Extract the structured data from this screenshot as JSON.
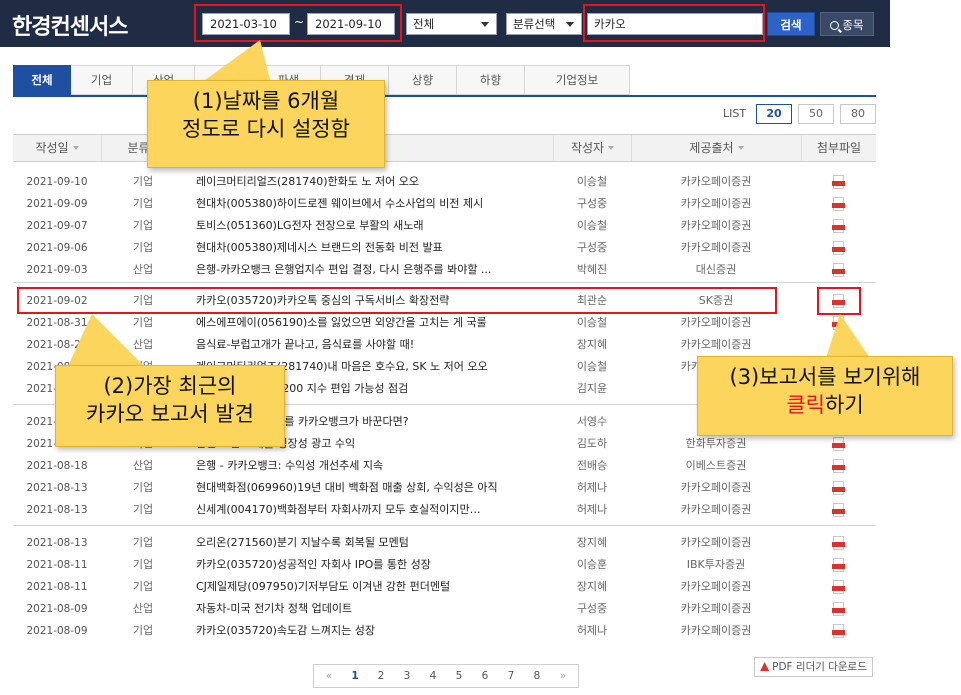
{
  "header": {
    "logo": "한경컨센서스",
    "date_from": "2021-03-10",
    "tilde": "~",
    "date_to": "2021-09-10",
    "type_select": "전체",
    "category_select": "분류선택",
    "search_value": "카카오",
    "search_button": "검색",
    "stock_button": "종목"
  },
  "tabs": [
    "전체",
    "기업",
    "산업",
    "시장",
    "파생",
    "경제",
    "상향",
    "하향",
    "기업정보"
  ],
  "list_size": {
    "label": "LIST",
    "options": [
      "20",
      "50",
      "80"
    ],
    "selected": "20"
  },
  "table": {
    "headers": [
      "작성일",
      "분류",
      "제목",
      "작성자",
      "제공출처",
      "첨부파일"
    ],
    "rows": [
      {
        "date": "2021-09-10",
        "cat": "기업",
        "title": "레이크머티리얼즈(281740)한화도 노 저어 오오",
        "author": "이승철",
        "source": "카카오페이증권"
      },
      {
        "date": "2021-09-09",
        "cat": "기업",
        "title": "현대차(005380)하이드로젠 웨이브에서 수소사업의 비전 제시",
        "author": "구성중",
        "source": "카카오페이증권"
      },
      {
        "date": "2021-09-07",
        "cat": "기업",
        "title": "토비스(051360)LG전자 전장으로 부활의 새노래",
        "author": "이승철",
        "source": "카카오페이증권"
      },
      {
        "date": "2021-09-06",
        "cat": "기업",
        "title": "현대차(005380)제네시스 브랜드의 전동화 비전 발표",
        "author": "구성중",
        "source": "카카오페이증권"
      },
      {
        "date": "2021-09-03",
        "cat": "산업",
        "title": "은행-카카오뱅크 은행업지수 편입 결정, 다시 은행주를 봐야할 ...",
        "author": "박혜진",
        "source": "대신증권"
      },
      {
        "date": "2021-09-02",
        "cat": "기업",
        "title": "카카오(035720)카카오톡 중심의 구독서비스 확장전략",
        "author": "최관순",
        "source": "SK증권"
      },
      {
        "date": "2021-08-31",
        "cat": "기업",
        "title": "에스에프에이(056190)소를 잃었으면 외양간을 고치는 게 국룰",
        "author": "이승철",
        "source": "카카오페이증권"
      },
      {
        "date": "2021-08-26",
        "cat": "산업",
        "title": "음식료-부럽고개가 끝나고, 음식료를 사야할 때!",
        "author": "장지혜",
        "source": "카카오페이증권"
      },
      {
        "date": "2021-08-24",
        "cat": "기업",
        "title": "레이크머티리얼즈(281740)내 마음은 호수요, SK 노 저어 오오",
        "author": "이승철",
        "source": "카카오페이증권"
      },
      {
        "date": "2021-08-23",
        "cat": "시장",
        "title": "카카오뱅크 KOSPI200 지수 편입 가능성 점검",
        "author": "김지윤",
        "source": ""
      },
      {
        "date": "2021-08-20",
        "cat": "산업",
        "title": "은행-은행업의 판도를 카카오뱅크가 바꾼다면?",
        "author": "서영수",
        "source": ""
      },
      {
        "date": "2021-08-19",
        "cat": "기업",
        "title": "관전 포인트 매출 성장성 광고 수익",
        "author": "김도하",
        "source": "한화투자증권"
      },
      {
        "date": "2021-08-18",
        "cat": "산업",
        "title": "은행 - 카카오뱅크: 수익성 개선추세 지속",
        "author": "전배승",
        "source": "이베스트증권"
      },
      {
        "date": "2021-08-13",
        "cat": "기업",
        "title": "현대백화점(069960)19년 대비 백화점 매출 상회, 수익성은 아직",
        "author": "허제나",
        "source": "카카오페이증권"
      },
      {
        "date": "2021-08-13",
        "cat": "기업",
        "title": "신세계(004170)백화점부터 자회사까지 모두 호실적이지만…",
        "author": "허제나",
        "source": "카카오페이증권"
      },
      {
        "date": "2021-08-13",
        "cat": "기업",
        "title": "오리온(271560)분기 지날수록 회복될 모멘텀",
        "author": "장지혜",
        "source": "카카오페이증권"
      },
      {
        "date": "2021-08-11",
        "cat": "기업",
        "title": "카카오(035720)성공적인 자회사 IPO를 통한 성장",
        "author": "이승훈",
        "source": "IBK투자증권"
      },
      {
        "date": "2021-08-11",
        "cat": "기업",
        "title": "CJ제일제당(097950)기저부담도 이겨낸 강한 펀더멘털",
        "author": "장지혜",
        "source": "카카오페이증권"
      },
      {
        "date": "2021-08-09",
        "cat": "산업",
        "title": "자동차-미국 전기차 정책 업데이트",
        "author": "구성중",
        "source": "카카오페이증권"
      },
      {
        "date": "2021-08-09",
        "cat": "기업",
        "title": "카카오(035720)속도감 느껴지는 성장",
        "author": "허제나",
        "source": "카카오페이증권"
      }
    ]
  },
  "pagination": {
    "prev": "«",
    "pages": [
      "1",
      "2",
      "3",
      "4",
      "5",
      "6",
      "7",
      "8"
    ],
    "current": "1",
    "next": "»"
  },
  "pdf_reader_label": "PDF 리더기 다운로드",
  "annotations": {
    "note1": [
      "(1)날짜를 6개월",
      "정도로 다시 설정함"
    ],
    "note2": [
      "(2)가장 최근의",
      "카카오 보고서 발견"
    ],
    "note3_line1": "(3)보고서를 보기위해",
    "note3_click": "클릭",
    "note3_rest": "하기"
  },
  "colors": {
    "header_bg": "#1f2c44",
    "accent": "#1f4fa0",
    "highlight": "#e5151e",
    "callout": "#fbd55c",
    "pdf_icon": "#d9342b"
  },
  "icons": {
    "search": "magnifier-icon",
    "sort": "sort-arrow-icon",
    "attachment": "pdf-file-icon"
  }
}
